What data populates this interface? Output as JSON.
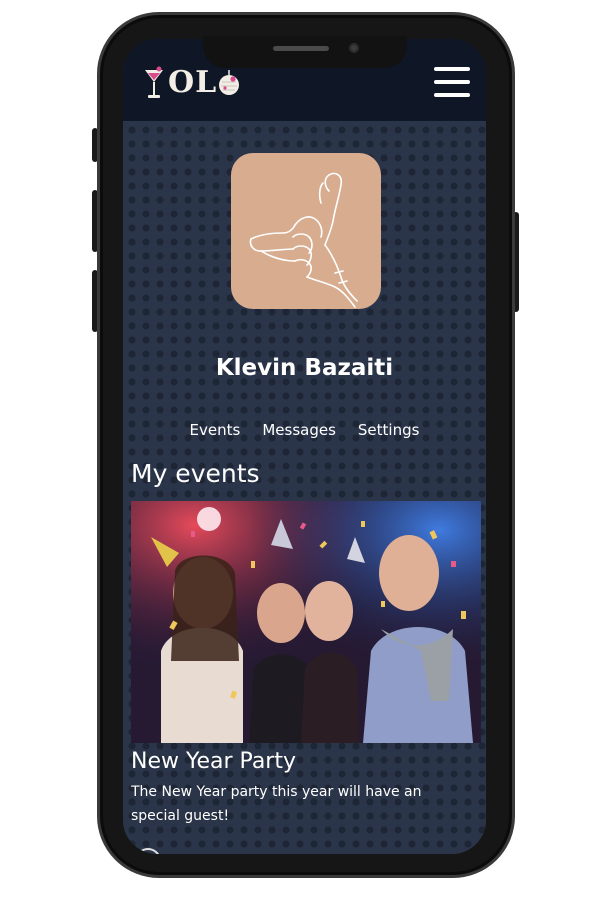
{
  "app": {
    "logo_text": "OL",
    "logo_icons": [
      "cocktail-glass-icon",
      "disco-ball-icon"
    ],
    "menu_icon": "hamburger-menu-icon"
  },
  "profile": {
    "name": "Klevin Bazaiti",
    "avatar_icon": "shaka-hand-icon",
    "nav": {
      "events": "Events",
      "messages": "Messages",
      "settings": "Settings"
    }
  },
  "events_section": {
    "title": "My events",
    "items": [
      {
        "title": "New Year Party",
        "description": "The New Year party this year will have an special guest!",
        "image": "party-photo"
      }
    ]
  },
  "colors": {
    "header": "#0f1626",
    "background": "#2b3549",
    "avatar_bg": "#d7ac8f",
    "text": "#ffffff"
  }
}
